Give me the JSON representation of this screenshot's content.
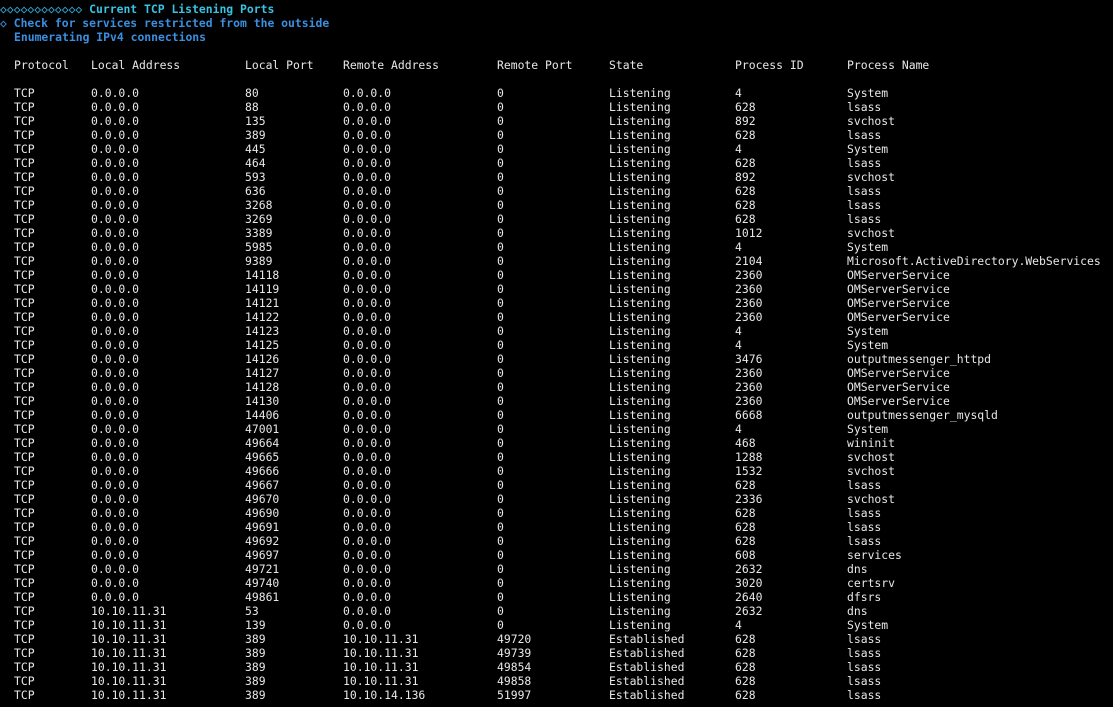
{
  "terminal": {
    "section_title_prefix": "◇◇◇◇◇◇◇◇◇◇◇◇",
    "section_title": "Current TCP Listening Ports",
    "check_prefix": "◇",
    "check_line": "Check for services restricted from the outside",
    "enum_line": "Enumerating IPv4 connections"
  },
  "table": {
    "columns": [
      "Protocol",
      "Local Address",
      "Local Port",
      "Remote Address",
      "Remote Port",
      "State",
      "Process ID",
      "Process Name"
    ],
    "rows": [
      [
        "TCP",
        "0.0.0.0",
        "80",
        "0.0.0.0",
        "0",
        "Listening",
        "4",
        "System"
      ],
      [
        "TCP",
        "0.0.0.0",
        "88",
        "0.0.0.0",
        "0",
        "Listening",
        "628",
        "lsass"
      ],
      [
        "TCP",
        "0.0.0.0",
        "135",
        "0.0.0.0",
        "0",
        "Listening",
        "892",
        "svchost"
      ],
      [
        "TCP",
        "0.0.0.0",
        "389",
        "0.0.0.0",
        "0",
        "Listening",
        "628",
        "lsass"
      ],
      [
        "TCP",
        "0.0.0.0",
        "445",
        "0.0.0.0",
        "0",
        "Listening",
        "4",
        "System"
      ],
      [
        "TCP",
        "0.0.0.0",
        "464",
        "0.0.0.0",
        "0",
        "Listening",
        "628",
        "lsass"
      ],
      [
        "TCP",
        "0.0.0.0",
        "593",
        "0.0.0.0",
        "0",
        "Listening",
        "892",
        "svchost"
      ],
      [
        "TCP",
        "0.0.0.0",
        "636",
        "0.0.0.0",
        "0",
        "Listening",
        "628",
        "lsass"
      ],
      [
        "TCP",
        "0.0.0.0",
        "3268",
        "0.0.0.0",
        "0",
        "Listening",
        "628",
        "lsass"
      ],
      [
        "TCP",
        "0.0.0.0",
        "3269",
        "0.0.0.0",
        "0",
        "Listening",
        "628",
        "lsass"
      ],
      [
        "TCP",
        "0.0.0.0",
        "3389",
        "0.0.0.0",
        "0",
        "Listening",
        "1012",
        "svchost"
      ],
      [
        "TCP",
        "0.0.0.0",
        "5985",
        "0.0.0.0",
        "0",
        "Listening",
        "4",
        "System"
      ],
      [
        "TCP",
        "0.0.0.0",
        "9389",
        "0.0.0.0",
        "0",
        "Listening",
        "2104",
        "Microsoft.ActiveDirectory.WebServices"
      ],
      [
        "TCP",
        "0.0.0.0",
        "14118",
        "0.0.0.0",
        "0",
        "Listening",
        "2360",
        "OMServerService"
      ],
      [
        "TCP",
        "0.0.0.0",
        "14119",
        "0.0.0.0",
        "0",
        "Listening",
        "2360",
        "OMServerService"
      ],
      [
        "TCP",
        "0.0.0.0",
        "14121",
        "0.0.0.0",
        "0",
        "Listening",
        "2360",
        "OMServerService"
      ],
      [
        "TCP",
        "0.0.0.0",
        "14122",
        "0.0.0.0",
        "0",
        "Listening",
        "2360",
        "OMServerService"
      ],
      [
        "TCP",
        "0.0.0.0",
        "14123",
        "0.0.0.0",
        "0",
        "Listening",
        "4",
        "System"
      ],
      [
        "TCP",
        "0.0.0.0",
        "14125",
        "0.0.0.0",
        "0",
        "Listening",
        "4",
        "System"
      ],
      [
        "TCP",
        "0.0.0.0",
        "14126",
        "0.0.0.0",
        "0",
        "Listening",
        "3476",
        "outputmessenger_httpd"
      ],
      [
        "TCP",
        "0.0.0.0",
        "14127",
        "0.0.0.0",
        "0",
        "Listening",
        "2360",
        "OMServerService"
      ],
      [
        "TCP",
        "0.0.0.0",
        "14128",
        "0.0.0.0",
        "0",
        "Listening",
        "2360",
        "OMServerService"
      ],
      [
        "TCP",
        "0.0.0.0",
        "14130",
        "0.0.0.0",
        "0",
        "Listening",
        "2360",
        "OMServerService"
      ],
      [
        "TCP",
        "0.0.0.0",
        "14406",
        "0.0.0.0",
        "0",
        "Listening",
        "6668",
        "outputmessenger_mysqld"
      ],
      [
        "TCP",
        "0.0.0.0",
        "47001",
        "0.0.0.0",
        "0",
        "Listening",
        "4",
        "System"
      ],
      [
        "TCP",
        "0.0.0.0",
        "49664",
        "0.0.0.0",
        "0",
        "Listening",
        "468",
        "wininit"
      ],
      [
        "TCP",
        "0.0.0.0",
        "49665",
        "0.0.0.0",
        "0",
        "Listening",
        "1288",
        "svchost"
      ],
      [
        "TCP",
        "0.0.0.0",
        "49666",
        "0.0.0.0",
        "0",
        "Listening",
        "1532",
        "svchost"
      ],
      [
        "TCP",
        "0.0.0.0",
        "49667",
        "0.0.0.0",
        "0",
        "Listening",
        "628",
        "lsass"
      ],
      [
        "TCP",
        "0.0.0.0",
        "49670",
        "0.0.0.0",
        "0",
        "Listening",
        "2336",
        "svchost"
      ],
      [
        "TCP",
        "0.0.0.0",
        "49690",
        "0.0.0.0",
        "0",
        "Listening",
        "628",
        "lsass"
      ],
      [
        "TCP",
        "0.0.0.0",
        "49691",
        "0.0.0.0",
        "0",
        "Listening",
        "628",
        "lsass"
      ],
      [
        "TCP",
        "0.0.0.0",
        "49692",
        "0.0.0.0",
        "0",
        "Listening",
        "628",
        "lsass"
      ],
      [
        "TCP",
        "0.0.0.0",
        "49697",
        "0.0.0.0",
        "0",
        "Listening",
        "608",
        "services"
      ],
      [
        "TCP",
        "0.0.0.0",
        "49721",
        "0.0.0.0",
        "0",
        "Listening",
        "2632",
        "dns"
      ],
      [
        "TCP",
        "0.0.0.0",
        "49740",
        "0.0.0.0",
        "0",
        "Listening",
        "3020",
        "certsrv"
      ],
      [
        "TCP",
        "0.0.0.0",
        "49861",
        "0.0.0.0",
        "0",
        "Listening",
        "2640",
        "dfsrs"
      ],
      [
        "TCP",
        "10.10.11.31",
        "53",
        "0.0.0.0",
        "0",
        "Listening",
        "2632",
        "dns"
      ],
      [
        "TCP",
        "10.10.11.31",
        "139",
        "0.0.0.0",
        "0",
        "Listening",
        "4",
        "System"
      ],
      [
        "TCP",
        "10.10.11.31",
        "389",
        "10.10.11.31",
        "49720",
        "Established",
        "628",
        "lsass"
      ],
      [
        "TCP",
        "10.10.11.31",
        "389",
        "10.10.11.31",
        "49739",
        "Established",
        "628",
        "lsass"
      ],
      [
        "TCP",
        "10.10.11.31",
        "389",
        "10.10.11.31",
        "49854",
        "Established",
        "628",
        "lsass"
      ],
      [
        "TCP",
        "10.10.11.31",
        "389",
        "10.10.11.31",
        "49858",
        "Established",
        "628",
        "lsass"
      ],
      [
        "TCP",
        "10.10.11.31",
        "389",
        "10.10.14.136",
        "51997",
        "Established",
        "628",
        "lsass"
      ]
    ]
  }
}
